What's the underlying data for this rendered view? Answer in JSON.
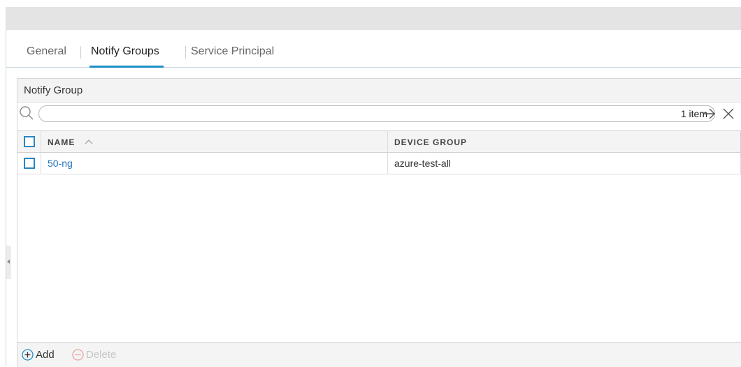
{
  "tabs": [
    {
      "label": "General",
      "active": false
    },
    {
      "label": "Notify Groups",
      "active": true
    },
    {
      "label": "Service Principal",
      "active": false
    }
  ],
  "panel": {
    "title": "Notify Group",
    "search": {
      "value": "",
      "placeholder": "",
      "item_count": "1 item"
    },
    "columns": {
      "name": "NAME",
      "device_group": "DEVICE GROUP"
    },
    "rows": [
      {
        "name": "50-ng",
        "device_group": "azure-test-all"
      }
    ],
    "footer": {
      "add_label": "Add",
      "delete_label": "Delete"
    }
  },
  "icons": {
    "search": "search-icon",
    "go": "arrow-right-icon",
    "clear": "close-icon",
    "sort": "chevron-up-icon",
    "add": "plus-circle-icon",
    "delete": "minus-circle-icon",
    "collapse": "collapse-left-icon"
  },
  "colors": {
    "accent": "#1c8fc6",
    "link": "#1f74c1",
    "checkbox": "#2a86c3",
    "disabled": "#c6c6c6"
  }
}
